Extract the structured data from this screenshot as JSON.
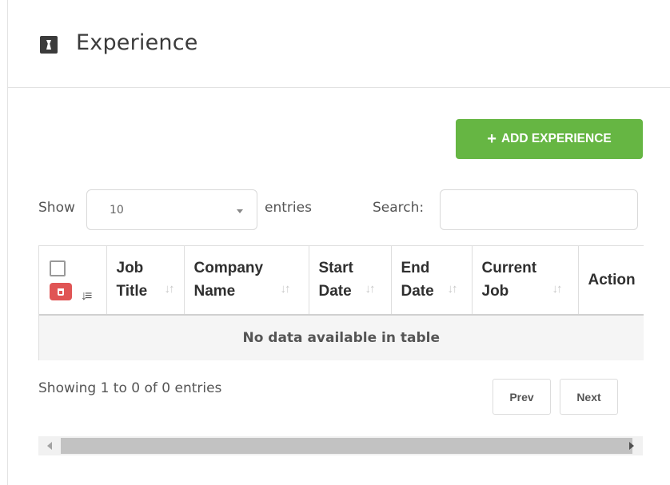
{
  "header": {
    "title": "Experience",
    "icon": "tie-icon"
  },
  "toolbar": {
    "add_label": "ADD EXPERIENCE",
    "add_color": "#66b643"
  },
  "length": {
    "show_label": "Show",
    "selected": "10",
    "entries_label": "entries"
  },
  "search": {
    "label": "Search:",
    "value": "",
    "placeholder": ""
  },
  "table": {
    "columns": [
      {
        "line1": "Job",
        "line2": "Title"
      },
      {
        "line1": "Company",
        "line2": "Name"
      },
      {
        "line1": "Start",
        "line2": "Date"
      },
      {
        "line1": "End",
        "line2": "Date"
      },
      {
        "line1": "Current",
        "line2": "Job"
      },
      {
        "line1": "Action",
        "line2": ""
      }
    ],
    "empty_message": "No data available in table",
    "delete_color": "#e05555"
  },
  "footer": {
    "info": "Showing 1 to 0 of 0 entries",
    "prev_label": "Prev",
    "next_label": "Next"
  }
}
